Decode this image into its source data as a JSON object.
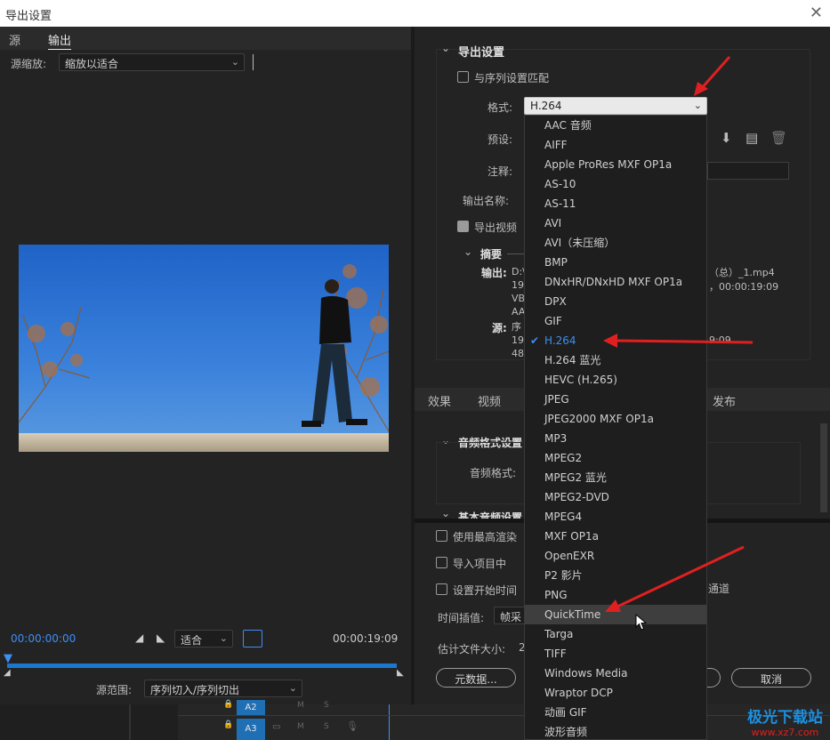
{
  "window": {
    "title": "导出设置",
    "close_icon": "close-icon"
  },
  "left": {
    "tabs": [
      "源",
      "输出"
    ],
    "zoom_label": "源缩放:",
    "zoom_value": "缩放以适合",
    "timecode_start": "00:00:00:00",
    "fit_value": "适合",
    "timecode_end": "00:00:19:09",
    "range_label": "源范围:",
    "range_value": "序列切入/序列切出"
  },
  "export_settings": {
    "header": "导出设置",
    "match_sequence": "与序列设置匹配",
    "format_label": "格式:",
    "format_value": "H.264",
    "preset_label": "预设:",
    "comment_label": "注释:",
    "output_name_label": "输出名称:",
    "export_video": "导出视频",
    "summary_label": "摘要",
    "output_label": "输出:",
    "output_lines": [
      "D:\\",
      "192",
      "VB",
      "AA"
    ],
    "output_right_1": "（总）_1.mp4",
    "output_right_2": "，00:00:19:09",
    "source_label": "源:",
    "source_lines": [
      "序",
      "192",
      "480"
    ],
    "source_right": "9:09"
  },
  "tabs2": {
    "effects": "效果",
    "video": "视频",
    "publish": "发布"
  },
  "audio": {
    "header": "音频格式设置",
    "format_label": "音频格式:",
    "basic_header": "基本音频设置"
  },
  "bottom_options": {
    "use_max_render": "使用最高渲染",
    "import_project": "导入项目中",
    "set_start_time": "设置开始时间",
    "channel": "通道",
    "time_interp_label": "时间插值:",
    "time_interp_value": "帧采",
    "file_size_label": "估计文件大小:",
    "file_size_value": "2",
    "metadata_button": "元数据...",
    "cancel_button": "取消"
  },
  "dropdown_items": [
    "AAC 音频",
    "AIFF",
    "Apple ProRes MXF OP1a",
    "AS-10",
    "AS-11",
    "AVI",
    "AVI（未压缩）",
    "BMP",
    "DNxHR/DNxHD MXF OP1a",
    "DPX",
    "GIF",
    "H.264",
    "H.264 蓝光",
    "HEVC (H.265)",
    "JPEG",
    "JPEG2000 MXF OP1a",
    "MP3",
    "MPEG2",
    "MPEG2 蓝光",
    "MPEG2-DVD",
    "MPEG4",
    "MXF OP1a",
    "OpenEXR",
    "P2 影片",
    "PNG",
    "QuickTime",
    "Targa",
    "TIFF",
    "Windows Media",
    "Wraptor DCP",
    "动画 GIF",
    "波形音频"
  ],
  "selected_item": "H.264",
  "hovered_item": "QuickTime",
  "timeline_tracks": [
    "A2",
    "A3"
  ],
  "timeline_flags": [
    "M",
    "S"
  ],
  "watermark": "极光下载站",
  "watermark_url": "www.xz7.com"
}
